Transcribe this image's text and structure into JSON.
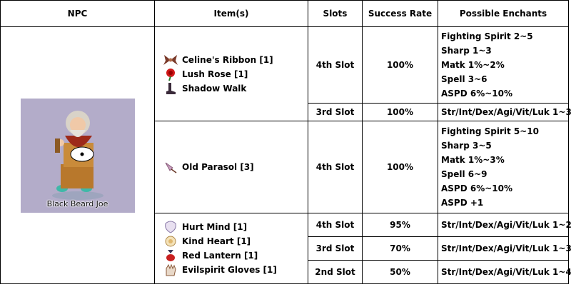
{
  "headers": {
    "npc": "NPC",
    "items": "Item(s)",
    "slots": "Slots",
    "rate": "Success Rate",
    "enchants": "Possible Enchants"
  },
  "npc": {
    "name": "Black Beard Joe",
    "icon": "bearded-old-man-sprite"
  },
  "groups": [
    {
      "items": [
        {
          "icon": "ribbon-icon",
          "name": "Celine's Ribbon [1]"
        },
        {
          "icon": "rose-icon",
          "name": "Lush Rose [1]"
        },
        {
          "icon": "shadow-walk-icon",
          "name": "Shadow Walk"
        }
      ],
      "slots": [
        {
          "slot": "4th Slot",
          "rate": "100%",
          "enchants": [
            "Fighting Spirit 2~5",
            "Sharp 1~3",
            "Matk 1%~2%",
            "Spell 3~6",
            "ASPD 6%~10%"
          ]
        },
        {
          "slot": "3rd Slot",
          "rate": "100%",
          "enchants": [
            "Str/Int/Dex/Agi/Vit/Luk 1~3"
          ]
        }
      ]
    },
    {
      "items": [
        {
          "icon": "parasol-icon",
          "name": "Old Parasol [3]"
        }
      ],
      "slots": [
        {
          "slot": "4th Slot",
          "rate": "100%",
          "enchants": [
            "Fighting Spirit 5~10",
            "Sharp 3~5",
            "Matk 1%~3%",
            "Spell 6~9",
            "ASPD 6%~10%",
            "ASPD +1"
          ]
        }
      ]
    },
    {
      "items": [
        {
          "icon": "hurt-mind-icon",
          "name": "Hurt Mind [1]"
        },
        {
          "icon": "kind-heart-icon",
          "name": "Kind Heart [1]"
        },
        {
          "icon": "red-lantern-icon",
          "name": "Red Lantern [1]"
        },
        {
          "icon": "evilspirit-gloves-icon",
          "name": "Evilspirit Gloves [1]"
        }
      ],
      "slots": [
        {
          "slot": "4th Slot",
          "rate": "95%",
          "enchants": [
            "Str/Int/Dex/Agi/Vit/Luk 1~2"
          ]
        },
        {
          "slot": "3rd Slot",
          "rate": "70%",
          "enchants": [
            "Str/Int/Dex/Agi/Vit/Luk 1~3"
          ]
        },
        {
          "slot": "2nd Slot",
          "rate": "50%",
          "enchants": [
            "Str/Int/Dex/Agi/Vit/Luk 1~4"
          ]
        }
      ]
    }
  ]
}
